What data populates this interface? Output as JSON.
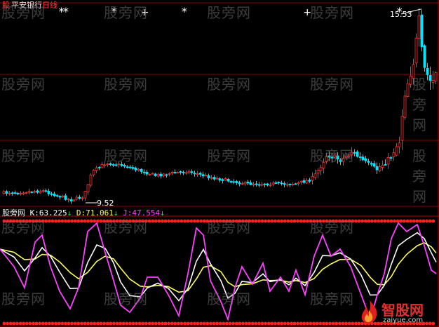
{
  "title_bar": {
    "brand": "股",
    "stock_name": "平安银行",
    "period": "日线"
  },
  "main_chart": {
    "price_high_label": "15.53",
    "price_low_label": "9.52",
    "colors": {
      "up": "#ff3030",
      "down": "#00e5ff",
      "grid": "#8b0000",
      "axis": "#b00000"
    },
    "events": [
      {
        "symbol": "*",
        "position": 0.14
      },
      {
        "symbol": "*",
        "position": 0.15
      },
      {
        "symbol": "*",
        "position": 0.26
      },
      {
        "symbol": "+",
        "position": 0.33
      },
      {
        "symbol": "*",
        "position": 0.42
      },
      {
        "symbol": "+",
        "position": 0.7
      },
      {
        "symbol": "*",
        "position": 0.91
      }
    ]
  },
  "indicator": {
    "name": "股旁网",
    "k_label": "K:",
    "k_value": "63.225",
    "d_label": "D:",
    "d_value": "71.061",
    "j_label": "J:",
    "j_value": "47.554",
    "arrow": "↓",
    "colors": {
      "k": "#ffffff",
      "d": "#ffff55",
      "j": "#ff40ff",
      "signal": "#ff2020"
    }
  },
  "watermark_text": "股旁网",
  "logo": {
    "brand": "智股网",
    "url": "zaiyue.com"
  }
}
